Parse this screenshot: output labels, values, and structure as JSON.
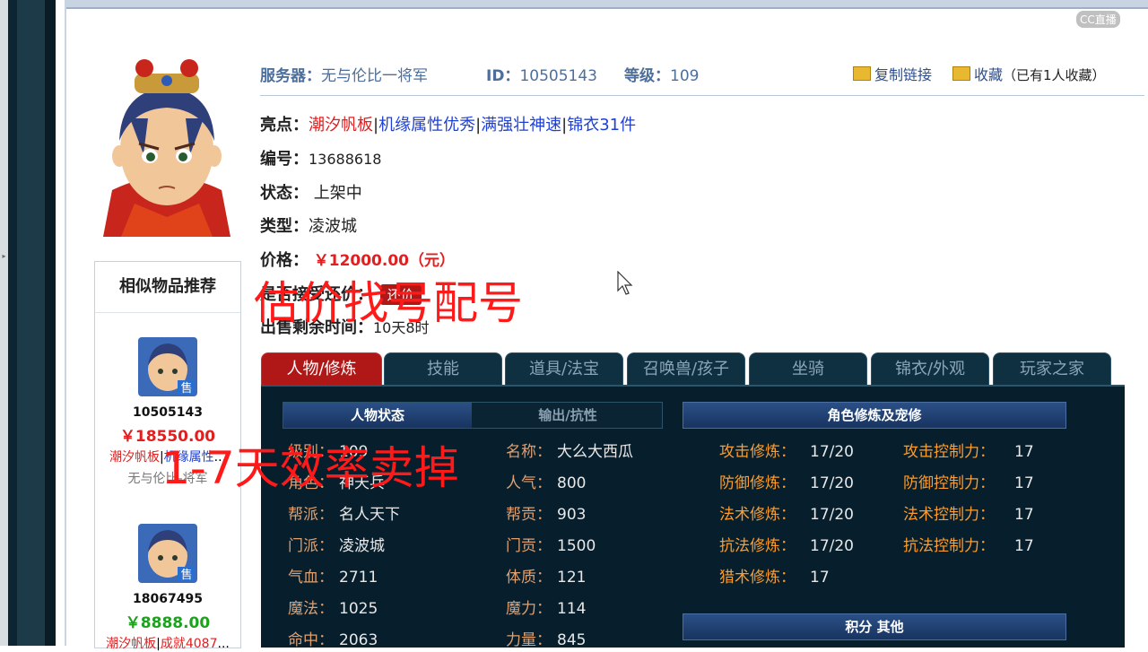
{
  "watermark": "CC直播",
  "header": {
    "server_label": "服务器：",
    "server_value": "无与伦比一将军",
    "id_label": "ID：",
    "id_value": "10505143",
    "level_label": "等级：",
    "level_value": "109",
    "copy_link": "复制链接",
    "favorite": "收藏",
    "favorite_note": "（已有1人收藏）"
  },
  "item": {
    "highlights_label": "亮点：",
    "highlights": [
      "潮汐帆板",
      "|",
      "机缘属性优秀",
      "|",
      "满强壮神速",
      "|",
      "锦衣31件"
    ],
    "number_label": "编号：",
    "number_value": "13688618",
    "status_label": "状态：",
    "status_value": "上架中",
    "type_label": "类型：",
    "type_value": "凌波城",
    "price_label": "价格：",
    "price_value": "￥12000.00（元）",
    "bargain_label": "是否接受还价：",
    "bargain_button": "还价",
    "remaining_label": "出售剩余时间：",
    "remaining_value": "10天8时"
  },
  "similar": {
    "title": "相似物品推荐",
    "sale_badge": "售",
    "items": [
      {
        "id": "10505143",
        "price": "￥18550.00",
        "tags": [
          "潮汐帆板",
          "|",
          "机缘属性",
          "..."
        ],
        "server": "无与伦比-将军",
        "price_color": "#e02020"
      },
      {
        "id": "18067495",
        "price": "￥8888.00",
        "tags": [
          "潮汐帆板",
          "|",
          "成就4087",
          "..."
        ],
        "server": "",
        "price_color": "#1fa01f"
      }
    ]
  },
  "tabs": [
    {
      "label": "人物/修炼",
      "active": true
    },
    {
      "label": "技能",
      "active": false
    },
    {
      "label": "道具/法宝",
      "active": false
    },
    {
      "label": "召唤兽/孩子",
      "active": false
    },
    {
      "label": "坐骑",
      "active": false
    },
    {
      "label": "锦衣/外观",
      "active": false
    },
    {
      "label": "玩家之家",
      "active": false
    }
  ],
  "panel": {
    "subtab_status": "人物状态",
    "subtab_output": "输出/抗性",
    "cultivation_header": "角色修炼及宠修",
    "score_header": "积分 其他",
    "status_col1": [
      {
        "k": "级别：",
        "v": "109"
      },
      {
        "k": "角色：",
        "v": "神天兵"
      },
      {
        "k": "帮派：",
        "v": "名人天下"
      },
      {
        "k": "门派：",
        "v": "凌波城"
      },
      {
        "k": "气血：",
        "v": "2711"
      },
      {
        "k": "魔法：",
        "v": "1025"
      },
      {
        "k": "命中：",
        "v": "2063"
      }
    ],
    "status_col2": [
      {
        "k": "名称：",
        "v": "大么大西瓜"
      },
      {
        "k": "人气：",
        "v": "800"
      },
      {
        "k": "帮贡：",
        "v": "903"
      },
      {
        "k": "门贡：",
        "v": "1500"
      },
      {
        "k": "体质：",
        "v": "121"
      },
      {
        "k": "魔力：",
        "v": "114"
      },
      {
        "k": "力量：",
        "v": "845"
      }
    ],
    "cultivation_col1": [
      {
        "k": "攻击修炼：",
        "v": "17/20"
      },
      {
        "k": "防御修炼：",
        "v": "17/20"
      },
      {
        "k": "法术修炼：",
        "v": "17/20"
      },
      {
        "k": "抗法修炼：",
        "v": "17/20"
      },
      {
        "k": "猎术修炼：",
        "v": "17"
      }
    ],
    "cultivation_col2": [
      {
        "k": "攻击控制力：",
        "v": "17"
      },
      {
        "k": "防御控制力：",
        "v": "17"
      },
      {
        "k": "法术控制力：",
        "v": "17"
      },
      {
        "k": "抗法控制力：",
        "v": "17"
      }
    ]
  },
  "overlays": {
    "text1": "估价找号配号",
    "text2": "1-7天效率卖掉"
  }
}
